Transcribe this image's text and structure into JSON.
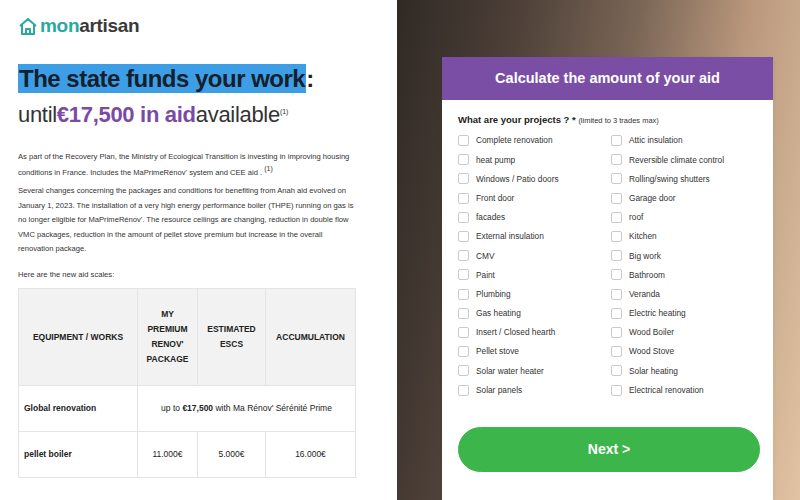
{
  "logo": {
    "prefix": "mon",
    "suffix": "artisan"
  },
  "headline": {
    "highlight": "The state funds your work",
    "colon": ":",
    "before": "until",
    "amount": "€17,500 in aid",
    "after": "available",
    "note": "(1)"
  },
  "intro": {
    "text": "As part of the Recovery Plan, the Ministry of Ecological Transition is investing in improving housing conditions in France. Includes the MaPrimeRénov' system and CEE aid .",
    "note": "(1)"
  },
  "changes": "Several changes concerning the packages and conditions for benefiting from Anah aid evolved on January 1, 2023. The installation of a very high energy performance boiler (THPE) running on gas is no longer eligible for MaPrimeRénov'. The resource ceilings are changing, reduction in double flow VMC packages, reduction in the amount of pellet stove premium but increase in the overall renovation package.",
  "scales_label": "Here are the new aid scales:",
  "table": {
    "columns": [
      "EQUIPMENT / WORKS",
      "MY PREMIUM RENOV' PACKAGE",
      "ESTIMATED ESCS",
      "ACCUMULATION"
    ],
    "rows": [
      {
        "kind": "merged",
        "label": "Global renovation",
        "parts": [
          {
            "text": "up to",
            "bold": false
          },
          {
            "text": "€17,500",
            "bold": true
          },
          {
            "text": "with Ma Rénov' Sérénité Prime",
            "bold": false
          }
        ]
      },
      {
        "kind": "values",
        "label": "pellet boiler",
        "values": [
          "11.000€",
          "5.000€",
          "16.000€"
        ]
      }
    ]
  },
  "form": {
    "title": "Calculate the amount of your aid",
    "question": "What are your projects ?",
    "required": "*",
    "limit": "(limited to 3 trades max)",
    "options": [
      {
        "label": "Complete renovation",
        "checked": false
      },
      {
        "label": "Attic insulation",
        "checked": false
      },
      {
        "label": "heat pump",
        "checked": false
      },
      {
        "label": "Reversible climate control",
        "checked": false
      },
      {
        "label": "Windows / Patio doors",
        "checked": false
      },
      {
        "label": "Rolling/swing shutters",
        "checked": false
      },
      {
        "label": "Front door",
        "checked": false
      },
      {
        "label": "Garage door",
        "checked": false
      },
      {
        "label": "facades",
        "checked": false
      },
      {
        "label": "roof",
        "checked": false
      },
      {
        "label": "External insulation",
        "checked": false
      },
      {
        "label": "Kitchen",
        "checked": false
      },
      {
        "label": "CMV",
        "checked": false
      },
      {
        "label": "Big work",
        "checked": false
      },
      {
        "label": "Paint",
        "checked": false
      },
      {
        "label": "Bathroom",
        "checked": false
      },
      {
        "label": "Plumbing",
        "checked": false
      },
      {
        "label": "Veranda",
        "checked": false
      },
      {
        "label": "Gas heating",
        "checked": false
      },
      {
        "label": "Electric heating",
        "checked": false
      },
      {
        "label": "Insert / Closed hearth",
        "checked": false
      },
      {
        "label": "Wood Boiler",
        "checked": false
      },
      {
        "label": "Pellet stove",
        "checked": false
      },
      {
        "label": "Wood Stove",
        "checked": false
      },
      {
        "label": "Solar water heater",
        "checked": false
      },
      {
        "label": "Solar heating",
        "checked": false
      },
      {
        "label": "Solar panels",
        "checked": false
      },
      {
        "label": "Electrical renovation",
        "checked": false
      }
    ],
    "next": "Next >"
  }
}
